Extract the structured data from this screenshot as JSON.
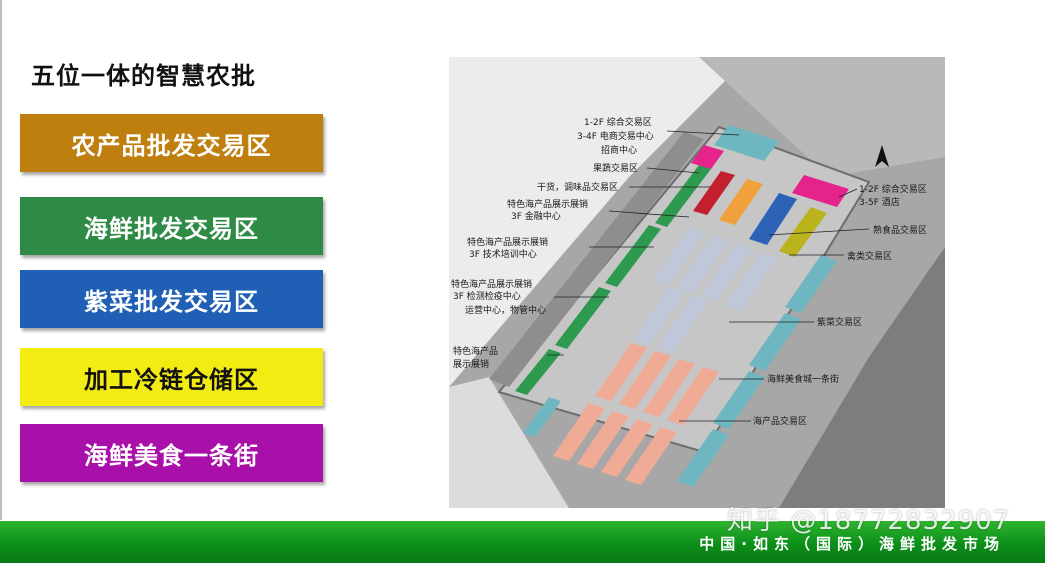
{
  "slide": {
    "title": "五位一体的智慧农批",
    "zones": [
      {
        "label": "农产品批发交易区",
        "bg": "#bf7f0f",
        "fg": "#ffffff"
      },
      {
        "label": "海鲜批发交易区",
        "bg": "#2e8b45",
        "fg": "#ffffff"
      },
      {
        "label": "紫菜批发交易区",
        "bg": "#1f5fb5",
        "fg": "#ffffff"
      },
      {
        "label": "加工冷链仓储区",
        "bg": "#f2ec12",
        "fg": "#111111"
      },
      {
        "label": "海鲜美食一条街",
        "bg": "#a90fa9",
        "fg": "#ffffff"
      }
    ],
    "footer": "中国·如东（国际）海鲜批发市场",
    "watermark": "知乎 @18772832907"
  },
  "map": {
    "labels": {
      "l1": "1-2F 综合交易区",
      "l2": "3-4F 电商交易中心",
      "l3": "招商中心",
      "l4": "果蔬交易区",
      "l5": "干货，调味品交易区",
      "l6": "特色海产品展示展销",
      "l7": "3F 金融中心",
      "l8": "特色海产品展示展销",
      "l9": "3F 技术培训中心",
      "l10": "特色海产品展示展销",
      "l11": "3F 检测检疫中心",
      "l12": "运营中心，物管中心",
      "l13": "特色海产品",
      "l14": "展示展销",
      "r1": "1-2F 综合交易区",
      "r2": "3-5F 酒店",
      "r3": "熟食品交易区",
      "r4": "禽类交易区",
      "r5": "紫菜交易区",
      "r6": "海鲜美食城一条街",
      "r7": "海产品交易区"
    }
  }
}
